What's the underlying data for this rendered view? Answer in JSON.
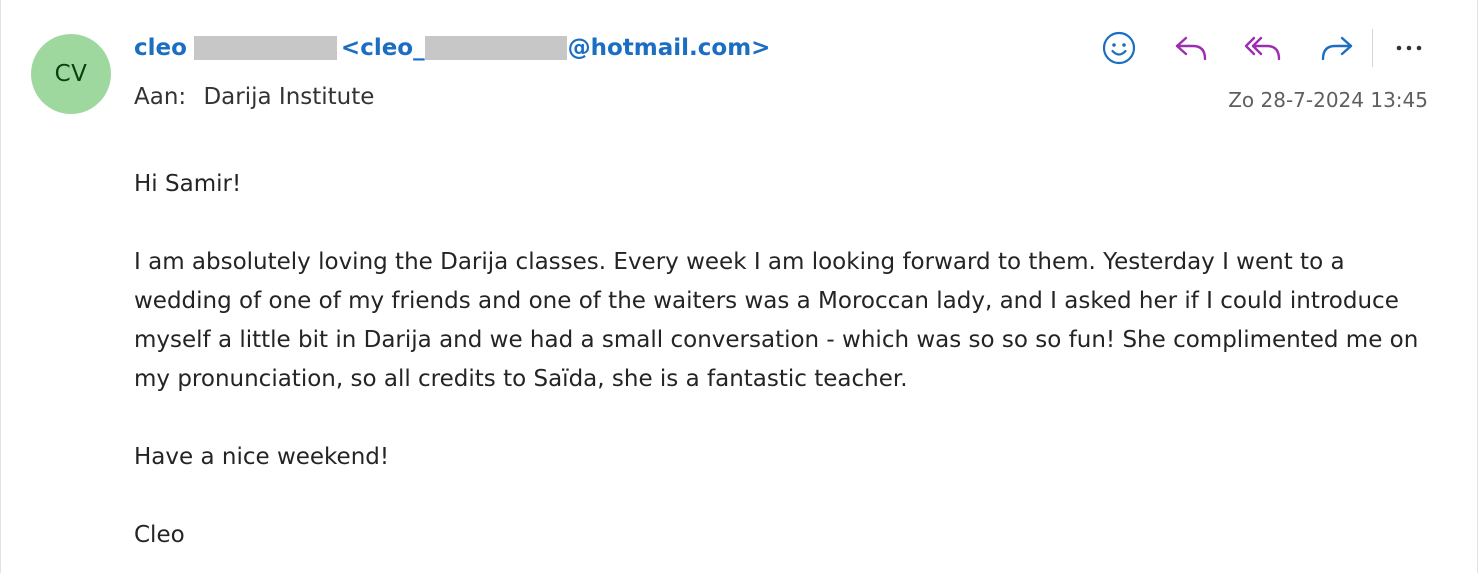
{
  "sender": {
    "initials": "CV",
    "name": "cleo",
    "email_prefix": "<cleo_",
    "email_suffix": "@hotmail.com>"
  },
  "recipient": {
    "label": "Aan:",
    "name": "Darija Institute"
  },
  "date": "Zo 28-7-2024 13:45",
  "actions": {
    "icons": [
      "emoji-icon",
      "reply-icon",
      "reply-all-icon",
      "forward-icon",
      "more-icon"
    ],
    "colors": {
      "emoji": "#1b6ec2",
      "reply": "#9b2fae",
      "forward": "#1b6ec2",
      "more": "#333333"
    }
  },
  "body": {
    "greeting": "Hi Samir!",
    "paragraph": "I am absolutely loving the Darija classes. Every week I am looking forward to them. Yesterday I went to a wedding of one of my friends and one of the waiters was a Moroccan lady, and I asked her if I could introduce myself a little bit in Darija and we had a small conversation - which was so so so fun! She complimented me on my pronunciation, so all credits to Saïda, she is a fantastic teacher.",
    "closing": "Have a nice weekend!",
    "signature": "Cleo"
  },
  "colors": {
    "avatar_bg": "#9fd89f",
    "avatar_text": "#0e3f0e",
    "link_blue": "#1b6ec2",
    "redaction": "#c7c7c7"
  }
}
